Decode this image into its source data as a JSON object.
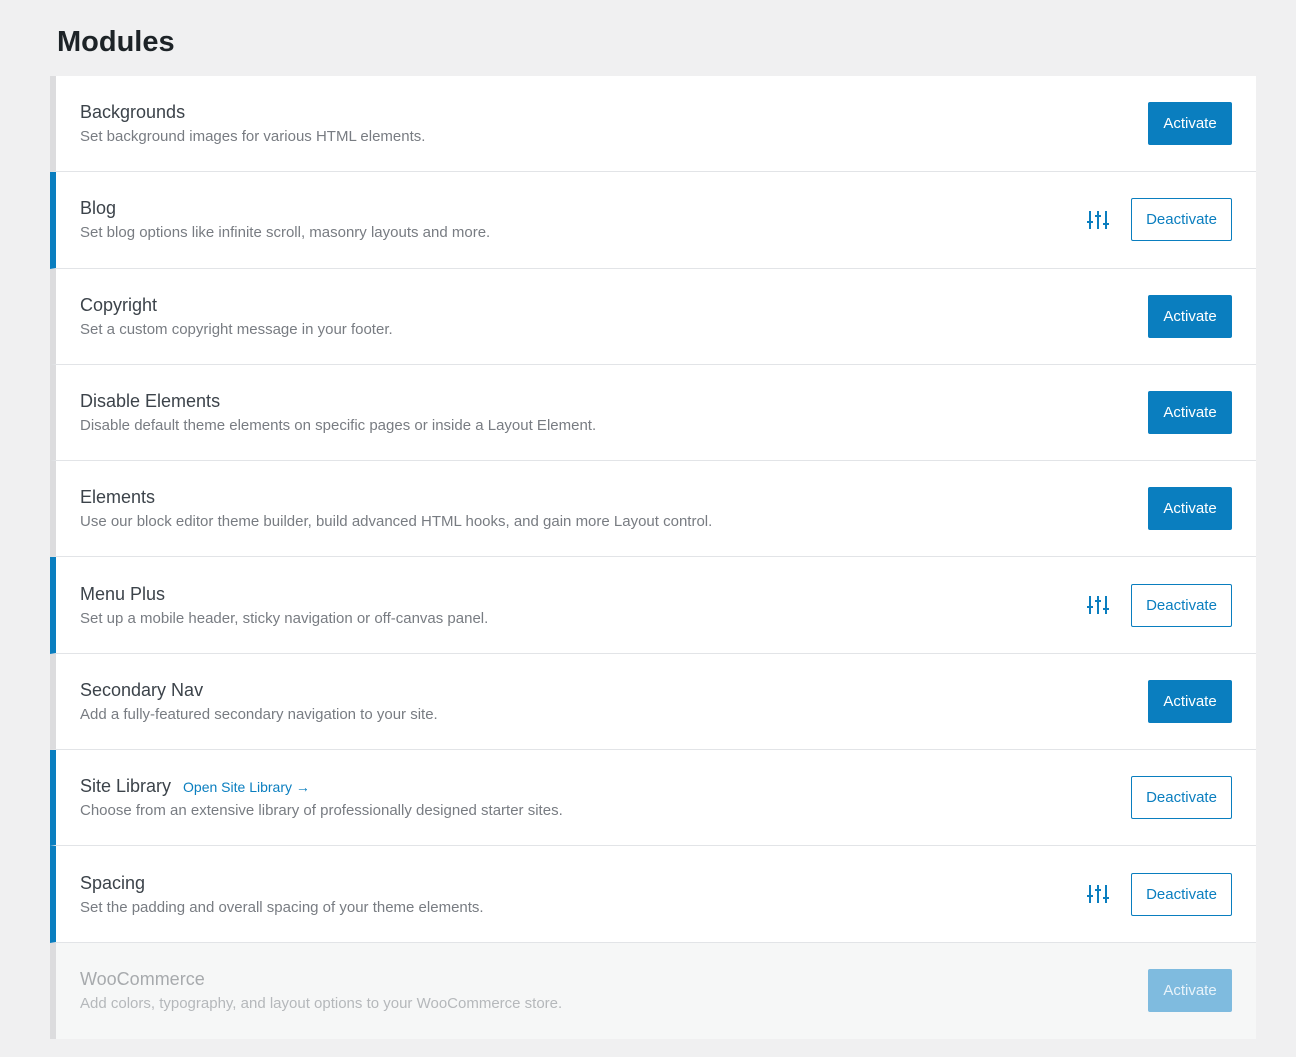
{
  "page": {
    "title": "Modules"
  },
  "colors": {
    "accent": "#0a7ebf",
    "inactive_border": "#dcdcde",
    "background": "#f0f0f1"
  },
  "modules": [
    {
      "title": "Backgrounds",
      "description": "Set background images for various HTML elements.",
      "status": "inactive",
      "button_label": "Activate",
      "has_settings": false,
      "link": ""
    },
    {
      "title": "Blog",
      "description": "Set blog options like infinite scroll, masonry layouts and more.",
      "status": "active",
      "button_label": "Deactivate",
      "has_settings": true,
      "link": ""
    },
    {
      "title": "Copyright",
      "description": "Set a custom copyright message in your footer.",
      "status": "inactive",
      "button_label": "Activate",
      "has_settings": false,
      "link": ""
    },
    {
      "title": "Disable Elements",
      "description": "Disable default theme elements on specific pages or inside a Layout Element.",
      "status": "inactive",
      "button_label": "Activate",
      "has_settings": false,
      "link": ""
    },
    {
      "title": "Elements",
      "description": "Use our block editor theme builder, build advanced HTML hooks, and gain more Layout control.",
      "status": "inactive",
      "button_label": "Activate",
      "has_settings": false,
      "link": ""
    },
    {
      "title": "Menu Plus",
      "description": "Set up a mobile header, sticky navigation or off-canvas panel.",
      "status": "active",
      "button_label": "Deactivate",
      "has_settings": true,
      "link": ""
    },
    {
      "title": "Secondary Nav",
      "description": "Add a fully-featured secondary navigation to your site.",
      "status": "inactive",
      "button_label": "Activate",
      "has_settings": false,
      "link": ""
    },
    {
      "title": "Site Library",
      "description": "Choose from an extensive library of professionally designed starter sites.",
      "status": "active",
      "button_label": "Deactivate",
      "has_settings": false,
      "link": "Open Site Library →"
    },
    {
      "title": "Spacing",
      "description": "Set the padding and overall spacing of your theme elements.",
      "status": "active",
      "button_label": "Deactivate",
      "has_settings": true,
      "link": ""
    },
    {
      "title": "WooCommerce",
      "description": "Add colors, typography, and layout options to your WooCommerce store.",
      "status": "disabled",
      "button_label": "Activate",
      "has_settings": false,
      "link": ""
    }
  ],
  "icons": {
    "settings": "sliders-icon"
  }
}
